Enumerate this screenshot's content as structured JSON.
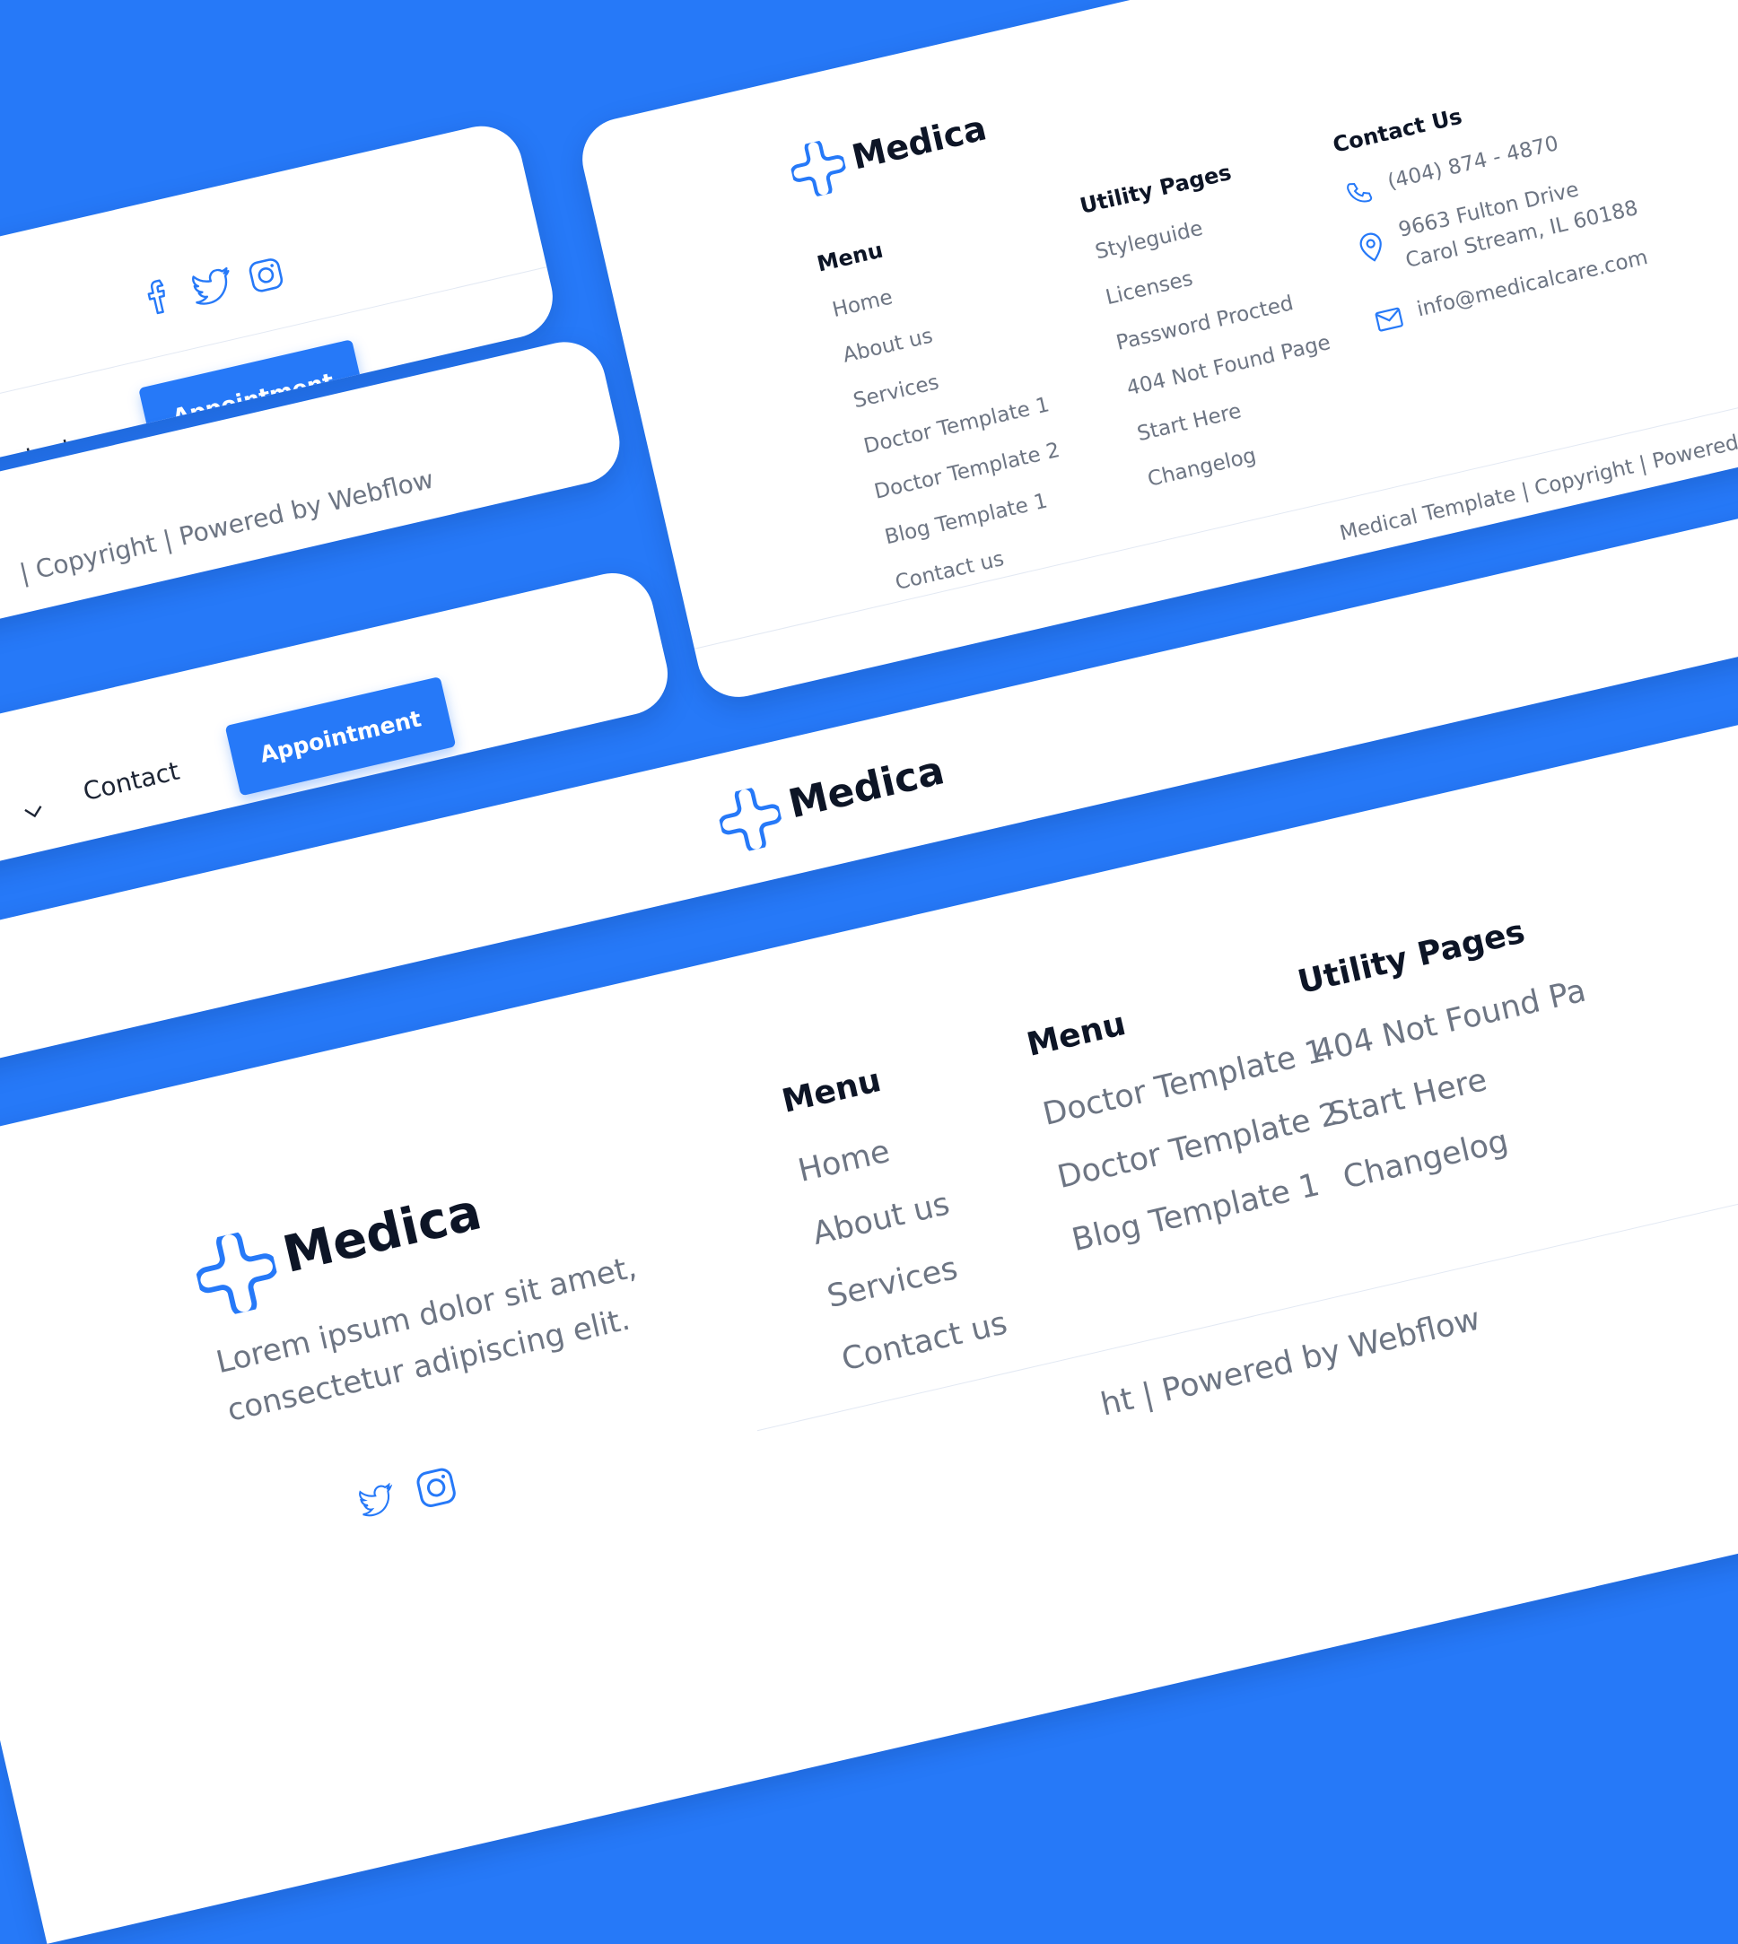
{
  "brand": {
    "name": "Medica",
    "color": "#2679F8"
  },
  "card1": {
    "social": [
      "facebook-icon",
      "twitter-icon",
      "instagram-icon"
    ],
    "nav_contact": "ntact",
    "appointment": "Appointment"
  },
  "card2": {
    "footer_text": "| Copyright | Powered by Webflow"
  },
  "card3": {
    "nav_contact": "Contact",
    "appointment": "Appointment"
  },
  "card4": {
    "logo": "Medica",
    "menu_heading": "Menu",
    "menu": [
      "Home",
      "About us",
      "Services",
      "Doctor Template 1",
      "Doctor Template 2",
      "Blog Template 1",
      "Contact us"
    ],
    "utility_heading": "Utility Pages",
    "utility": [
      "Styleguide",
      "Licenses",
      "Password Procted",
      "404 Not Found Page",
      "Start Here",
      "Changelog"
    ],
    "contact_heading": "Contact Us",
    "phone": "(404) 874 - 4870",
    "address_1": "9663 Fulton Drive",
    "address_2": "Carol Stream, IL 60188",
    "email": "info@medicalcare.com",
    "footer_text": "Medical Template | Copyright | Powered b"
  },
  "card5": {
    "logo": "Medica"
  },
  "card6": {
    "logo": "Medica",
    "tagline_1": "Lorem ipsum dolor sit amet,",
    "tagline_2": "consectetur adipiscing elit.",
    "menu_heading_1": "Menu",
    "menu_1": [
      "Home",
      "About us",
      "Services",
      "Contact us"
    ],
    "menu_heading_2": "Menu",
    "menu_2": [
      "Doctor Template 1",
      "Doctor Template 2",
      "Blog Template 1"
    ],
    "utility_heading": "Utility Pages",
    "utility": [
      "404 Not Found Pa",
      "Start Here",
      "Changelog"
    ],
    "footer_text": "ht | Powered by Webflow"
  }
}
